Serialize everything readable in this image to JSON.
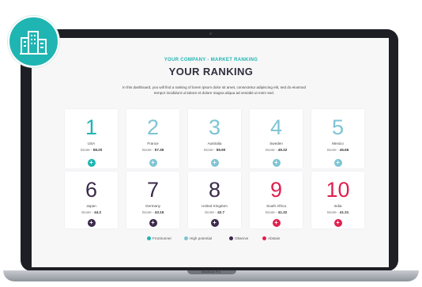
{
  "header": {
    "subtitle": "YOUR COMPANY - MARKET RANKING",
    "title": "YOUR RANKING",
    "description": "In this dashboard, you will find a ranking of lorem ipsum dolor sit amet, consectetur adipiscing elit, sed do eiusmod tempor incididunt ut labore et dolore magna aliqua ad veniabit ut enim sed."
  },
  "ranking": [
    {
      "rank": "1",
      "country": "USA",
      "score": "58.20",
      "status": "frontrunner"
    },
    {
      "rank": "2",
      "country": "France",
      "score": "57.36",
      "status": "high-potential"
    },
    {
      "rank": "3",
      "country": "Australia",
      "score": "55.90",
      "status": "high-potential"
    },
    {
      "rank": "4",
      "country": "Sweden",
      "score": "49.32",
      "status": "high-potential"
    },
    {
      "rank": "5",
      "country": "Mexico",
      "score": "45.66",
      "status": "high-potential"
    },
    {
      "rank": "6",
      "country": "Japan",
      "score": "44.2",
      "status": "observe"
    },
    {
      "rank": "7",
      "country": "Germany",
      "score": "43.16",
      "status": "observe"
    },
    {
      "rank": "8",
      "country": "United Kingdom",
      "score": "42.7",
      "status": "observe"
    },
    {
      "rank": "9",
      "country": "South Africa",
      "score": "41.32",
      "status": "abstain"
    },
    {
      "rank": "10",
      "country": "India",
      "score": "41.31",
      "status": "abstain"
    }
  ],
  "score_label": "Score - ",
  "legend": [
    {
      "label": "Frontrunner",
      "color": "#1fb5b2"
    },
    {
      "label": "High potential",
      "color": "#7ec4d4"
    },
    {
      "label": "Observe",
      "color": "#3b2a4a"
    },
    {
      "label": "Abstain",
      "color": "#e0204f"
    }
  ],
  "colors": {
    "frontrunner": "#1fb5b2",
    "high-potential": "#7ec4d4",
    "observe": "#3b2a4a",
    "abstain": "#e0204f",
    "badge": "#1fb5b2"
  },
  "badge_icon": "buildings-icon",
  "laptop_label": "MacBook Pro"
}
